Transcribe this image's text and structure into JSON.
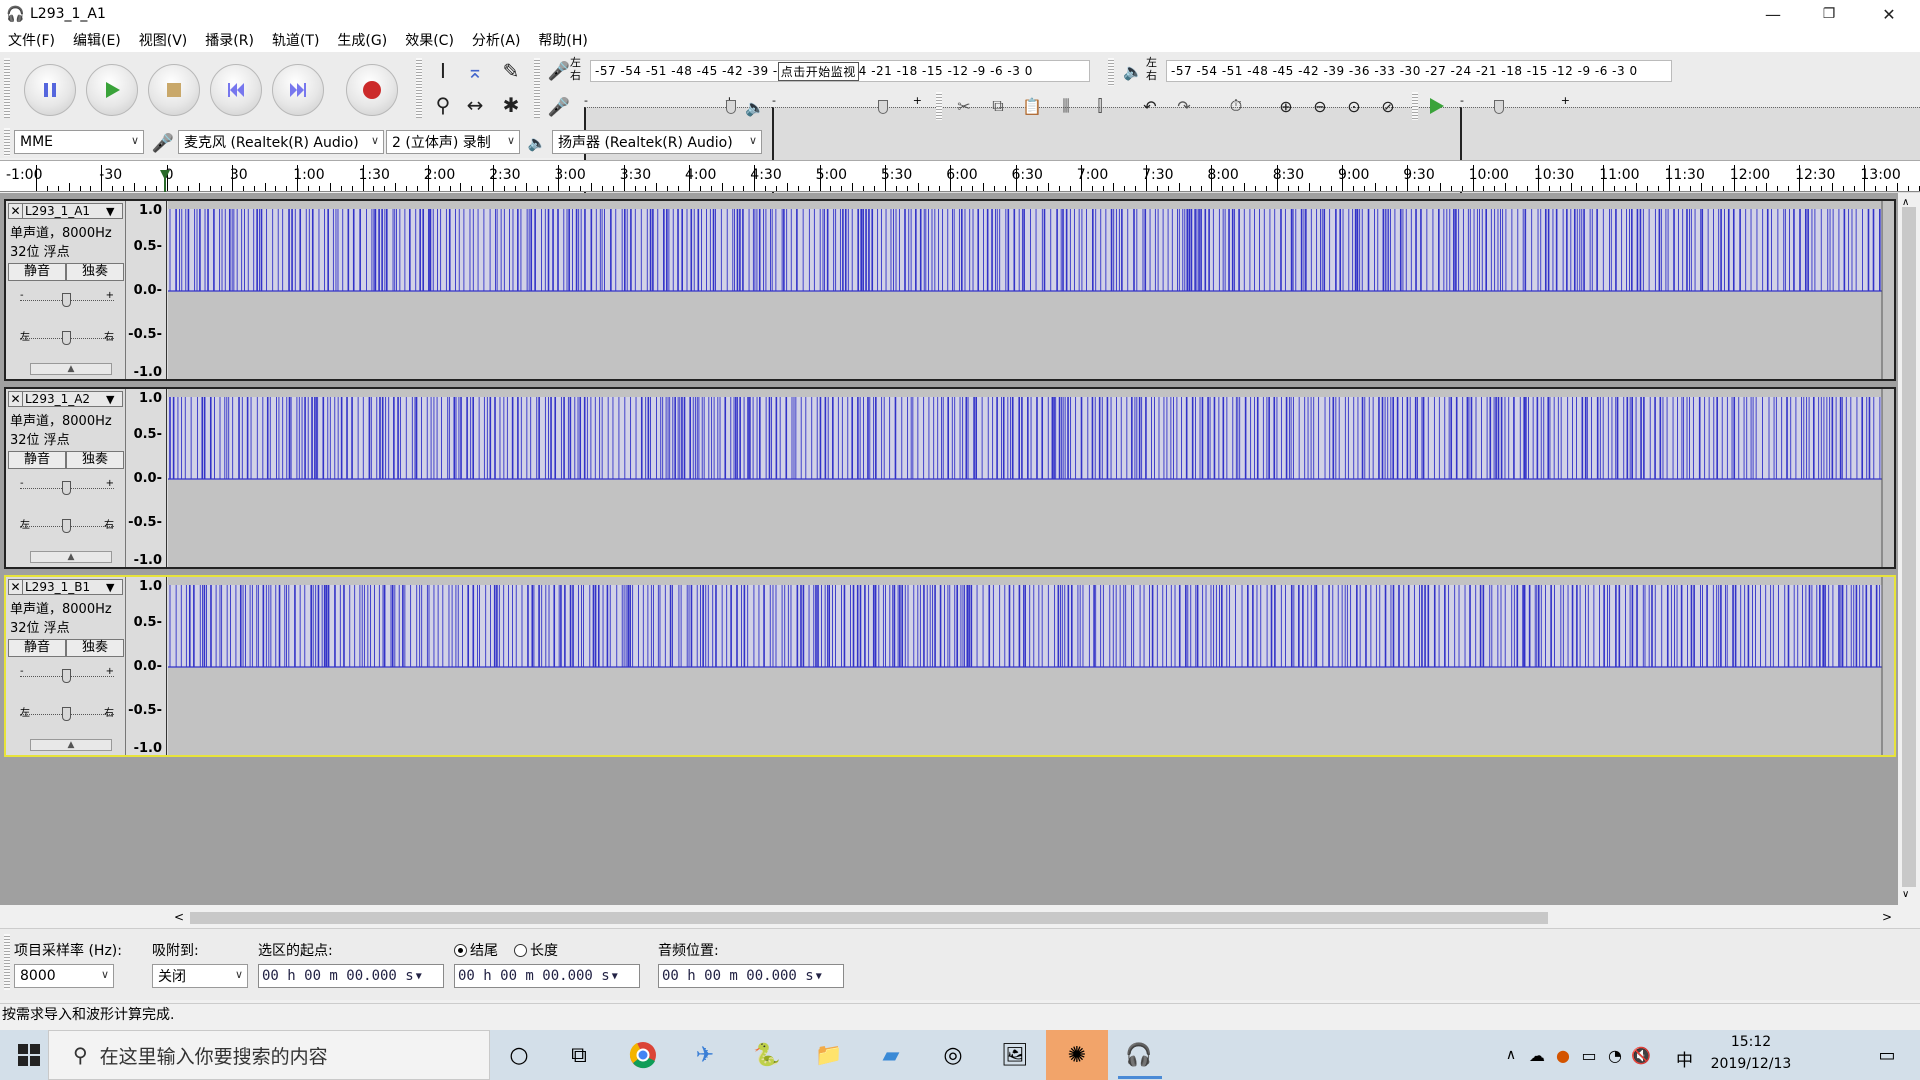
{
  "window": {
    "title": "L293_1_A1",
    "minimize": "—",
    "maximize": "❐",
    "close": "✕"
  },
  "menu": [
    "文件(F)",
    "编辑(E)",
    "视图(V)",
    "播录(R)",
    "轨道(T)",
    "生成(G)",
    "效果(C)",
    "分析(A)",
    "帮助(H)"
  ],
  "meter": {
    "record_lr": "左右",
    "record_scale_left": "-57 -54 -51 -48 -45 -42 -39 -",
    "record_hint": "点击开始监视",
    "record_scale_right": "4 -21 -18 -15 -12  -9  -6  -3  0",
    "play_lr": "左右",
    "play_scale": "-57 -54 -51 -48 -45 -42 -39 -36 -33 -30 -27 -24 -21 -18 -15 -12  -9  -6  -3  0",
    "slider_min": "-",
    "slider_max": "+"
  },
  "device": {
    "host": "MME",
    "mic": "麦克风 (Realtek(R) Audio)",
    "channels": "2 (立体声) 录制",
    "speaker": "扬声器 (Realtek(R) Audio)"
  },
  "ruler": [
    "-1:00",
    "-30",
    "0",
    "30",
    "1:00",
    "1:30",
    "2:00",
    "2:30",
    "3:00",
    "3:30",
    "4:00",
    "4:30",
    "5:00",
    "5:30",
    "6:00",
    "6:30",
    "7:00",
    "7:30",
    "8:00",
    "8:30",
    "9:00",
    "9:30",
    "10:00",
    "10:30",
    "11:00",
    "11:30",
    "12:00",
    "12:30",
    "13:00"
  ],
  "track_common": {
    "close": "✕",
    "dropdown": "▼",
    "format1": "单声道，8000Hz",
    "format2": "32位 浮点",
    "mute": "静音",
    "solo": "独奏",
    "gain_min": "-",
    "gain_max": "+",
    "pan_l": "左",
    "pan_r": "右",
    "collapse": "▲"
  },
  "y_labels": [
    "1.0",
    "0.5-",
    "0.0-",
    "-0.5-",
    "-1.0"
  ],
  "tracks": [
    {
      "name": "L293_1_A1",
      "selected": false
    },
    {
      "name": "L293_1_A2",
      "selected": false
    },
    {
      "name": "L293_1_B1",
      "selected": true
    }
  ],
  "colors": {
    "waveform": "#3232c8",
    "wave_bg": "#c2c2c2",
    "selected_border": "#e7e33a"
  },
  "selection": {
    "rate_label": "项目采样率 (Hz):",
    "rate_value": "8000",
    "snap_label": "吸附到:",
    "snap_value": "关闭",
    "start_label": "选区的起点:",
    "end_label": "结尾",
    "length_label": "长度",
    "audio_pos_label": "音频位置:",
    "start_time": "00 h 00 m 00.000 s",
    "end_time": "00 h 00 m 00.000 s",
    "audio_pos": "00 h 00 m 00.000 s"
  },
  "status": "按需求导入和波形计算完成.",
  "taskbar": {
    "search_placeholder": "在这里输入你要搜索的内容",
    "ime": "中",
    "time": "15:12",
    "date": "2019/12/13"
  }
}
